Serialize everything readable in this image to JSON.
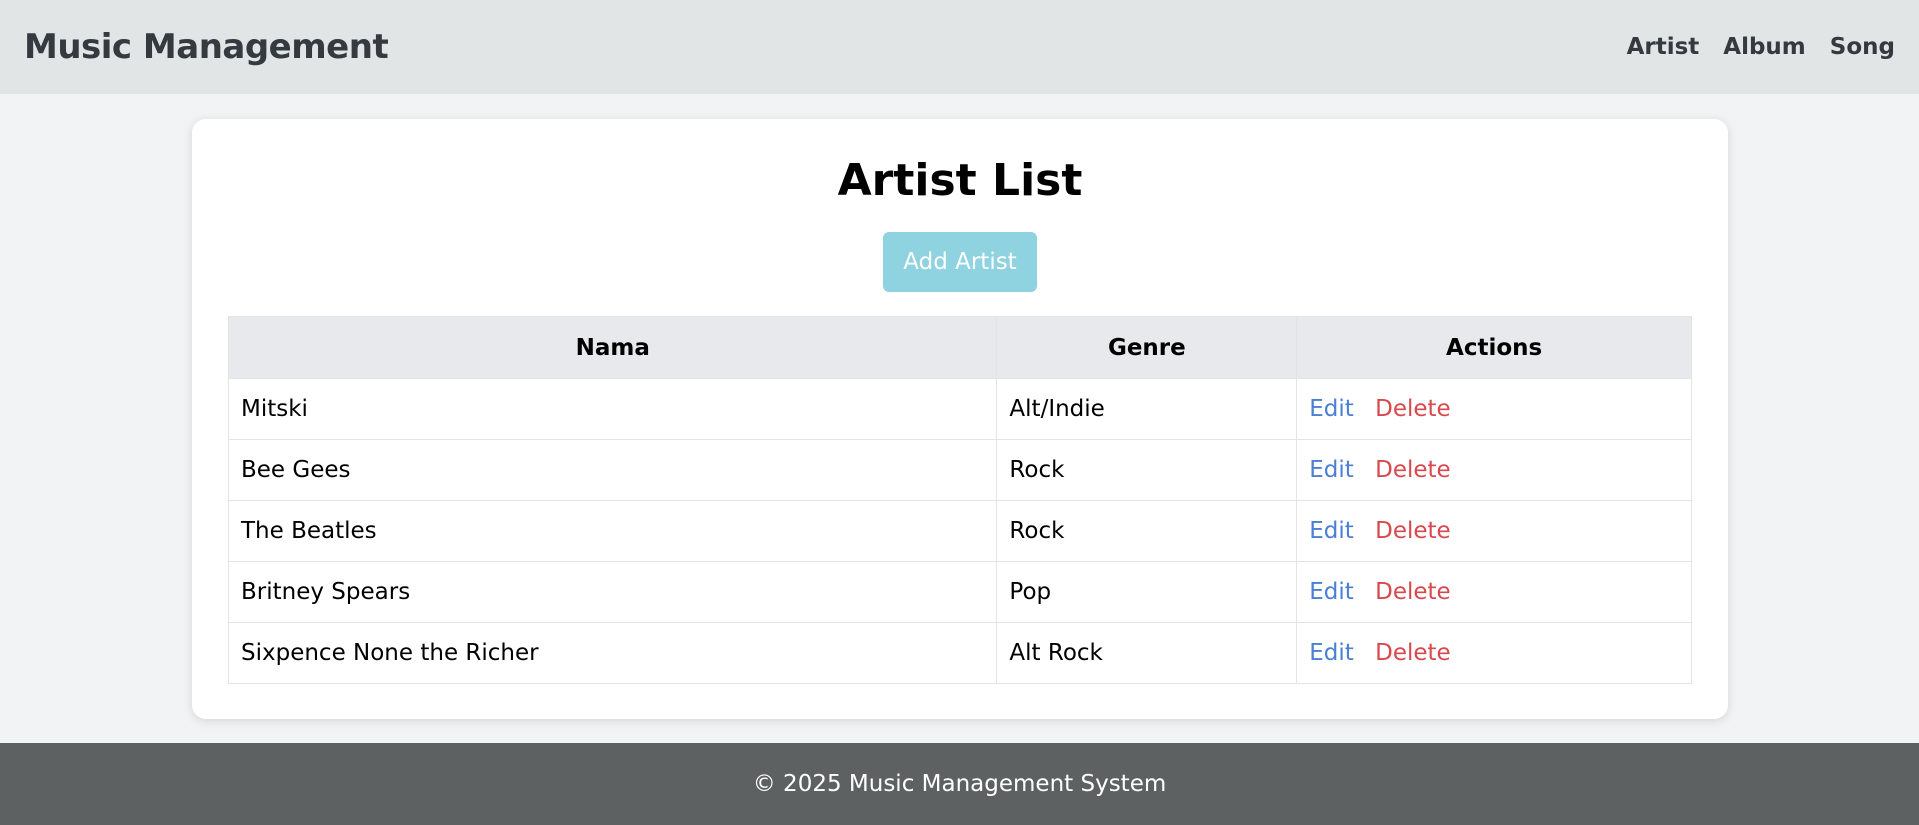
{
  "header": {
    "brand": "Music Management",
    "nav": [
      {
        "label": "Artist"
      },
      {
        "label": "Album"
      },
      {
        "label": "Song"
      }
    ]
  },
  "main": {
    "title": "Artist List",
    "add_button_label": "Add Artist",
    "table": {
      "columns": [
        "Nama",
        "Genre",
        "Actions"
      ],
      "rows": [
        {
          "name": "Mitski",
          "genre": "Alt/Indie",
          "edit": "Edit",
          "delete": "Delete"
        },
        {
          "name": "Bee Gees",
          "genre": "Rock",
          "edit": "Edit",
          "delete": "Delete"
        },
        {
          "name": "The Beatles",
          "genre": "Rock",
          "edit": "Edit",
          "delete": "Delete"
        },
        {
          "name": "Britney Spears",
          "genre": "Pop",
          "edit": "Edit",
          "delete": "Delete"
        },
        {
          "name": "Sixpence None the Richer",
          "genre": "Alt Rock",
          "edit": "Edit",
          "delete": "Delete"
        }
      ]
    }
  },
  "footer": {
    "text": "© 2025 Music Management System"
  },
  "colors": {
    "navbar_bg": "#e1e5e6",
    "add_button_bg": "#8fd3e1",
    "edit_link": "#4a7fd6",
    "delete_link": "#d9484d",
    "footer_bg": "#5e6162"
  }
}
